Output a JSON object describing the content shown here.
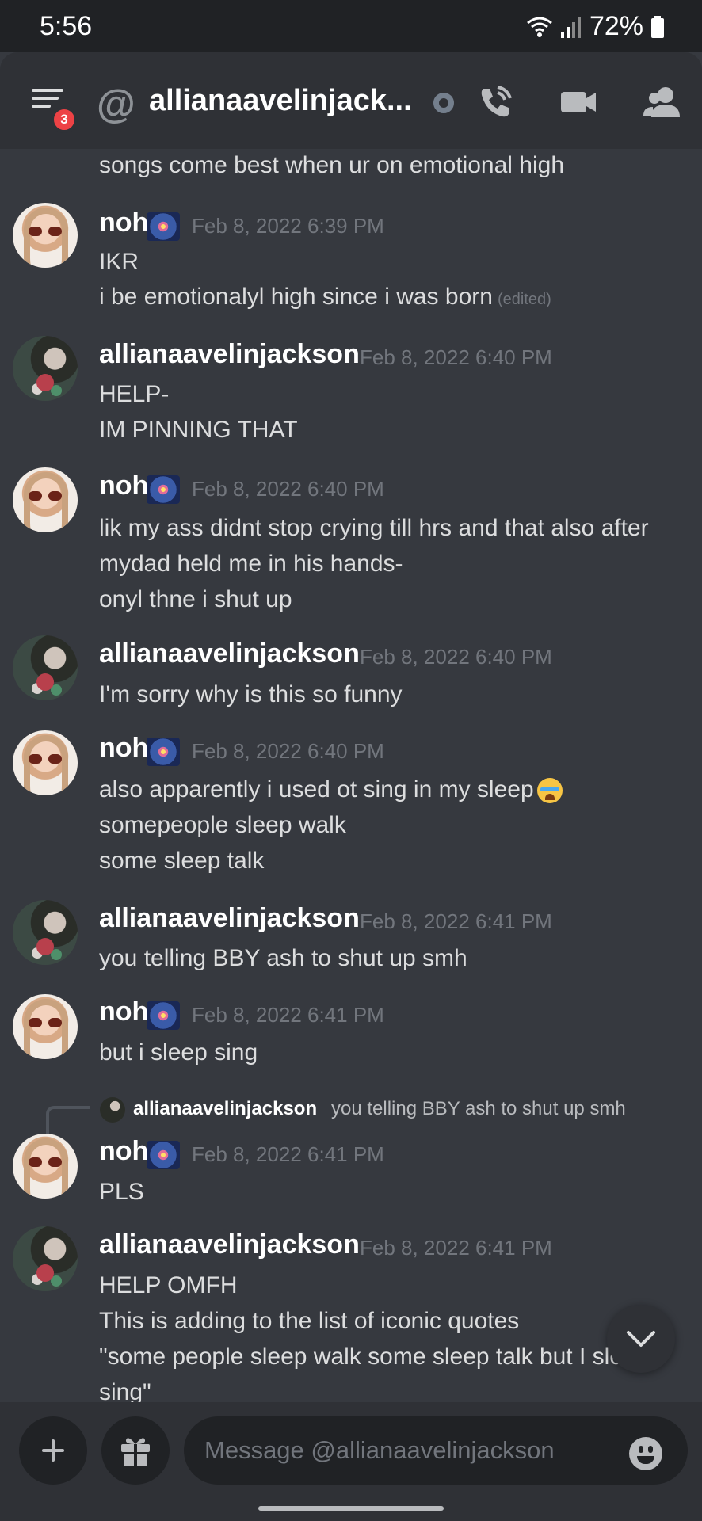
{
  "status": {
    "time": "5:56",
    "battery": "72%"
  },
  "header": {
    "badge_count": "3",
    "at_symbol": "@",
    "channel_name": "allianaavelinjack...",
    "icons": [
      "menu-icon",
      "at-icon",
      "voice-call-icon",
      "video-call-icon",
      "members-icon"
    ]
  },
  "messages": {
    "top_cut_line": "songs come best when ur on emotional high",
    "m1": {
      "user": "noh",
      "time": "Feb 8, 2022 6:39 PM",
      "lines": [
        "IKR",
        "i be emotionalyl high since i was born"
      ],
      "edited": "(edited)"
    },
    "m2": {
      "user": "allianaavelinjackson",
      "time": "Feb 8, 2022 6:40 PM",
      "lines": [
        "HELP-",
        "IM PINNING THAT"
      ]
    },
    "m3": {
      "user": "noh",
      "time": "Feb 8, 2022 6:40 PM",
      "lines": [
        "lik my ass didnt stop crying till hrs and that also after",
        "mydad held me in his hands-",
        "onyl thne i shut up"
      ]
    },
    "m4": {
      "user": "allianaavelinjackson",
      "time": "Feb 8, 2022 6:40 PM",
      "lines": [
        "I'm sorry why is this so funny"
      ]
    },
    "m5": {
      "user": "noh",
      "time": "Feb 8, 2022 6:40 PM",
      "lines": [
        "also apparently i used ot sing in my sleep",
        "somepeople sleep walk",
        "some sleep talk"
      ]
    },
    "m6": {
      "user": "allianaavelinjackson",
      "time": "Feb 8, 2022 6:41 PM",
      "lines": [
        "you telling BBY ash to shut up smh"
      ]
    },
    "m7": {
      "user": "noh",
      "time": "Feb 8, 2022 6:41 PM",
      "lines": [
        "but i sleep sing"
      ]
    },
    "reply": {
      "user": "allianaavelinjackson",
      "text": "you telling BBY ash to shut up smh"
    },
    "m8": {
      "user": "noh",
      "time": "Feb 8, 2022 6:41 PM",
      "lines": [
        "PLS"
      ]
    },
    "m9": {
      "user": "allianaavelinjackson",
      "time": "Feb 8, 2022 6:41 PM",
      "lines": [
        "HELP OMFH",
        "This is adding to the list of iconic quotes",
        "\"some people sleep walk some sleep talk but I sleep",
        "sing\""
      ]
    }
  },
  "composer": {
    "placeholder": "Message @allianaavelinjackson"
  },
  "colors": {
    "background": "#36393f",
    "header": "#2f3136",
    "input": "#202225",
    "badge": "#ed4245",
    "muted": "#72767d"
  }
}
